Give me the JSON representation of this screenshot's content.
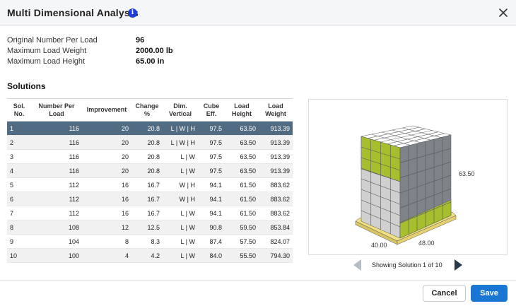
{
  "dialog": {
    "title": "Multi Dimensional Analysis",
    "info_icon": "info-icon",
    "close_icon": "close-icon"
  },
  "summary": [
    {
      "label": "Original Number Per Load",
      "value": "96"
    },
    {
      "label": "Maximum Load Weight",
      "value": "2000.00 lb"
    },
    {
      "label": "Maximum Load Height",
      "value": "65.00 in"
    }
  ],
  "solutions": {
    "heading": "Solutions",
    "columns": [
      {
        "line1": "Sol.",
        "line2": "No."
      },
      {
        "line1": "Number Per",
        "line2": "Load"
      },
      {
        "line1": "Improvement",
        "line2": ""
      },
      {
        "line1": "Change",
        "line2": "%"
      },
      {
        "line1": "Dim.",
        "line2": "Vertical"
      },
      {
        "line1": "Cube",
        "line2": "Eff."
      },
      {
        "line1": "Load",
        "line2": "Height"
      },
      {
        "line1": "Load",
        "line2": "Weight"
      }
    ],
    "rows": [
      [
        "1",
        "116",
        "20",
        "20.8",
        "L | W | H",
        "97.5",
        "63.50",
        "913.39"
      ],
      [
        "2",
        "116",
        "20",
        "20.8",
        "L | W | H",
        "97.5",
        "63.50",
        "913.39"
      ],
      [
        "3",
        "116",
        "20",
        "20.8",
        "L | W",
        "97.5",
        "63.50",
        "913.39"
      ],
      [
        "4",
        "116",
        "20",
        "20.8",
        "L | W",
        "97.5",
        "63.50",
        "913.39"
      ],
      [
        "5",
        "112",
        "16",
        "16.7",
        "W | H",
        "94.1",
        "61.50",
        "883.62"
      ],
      [
        "6",
        "112",
        "16",
        "16.7",
        "W | H",
        "94.1",
        "61.50",
        "883.62"
      ],
      [
        "7",
        "112",
        "16",
        "16.7",
        "L | W",
        "94.1",
        "61.50",
        "883.62"
      ],
      [
        "8",
        "108",
        "12",
        "12.5",
        "L | W",
        "90.8",
        "59.50",
        "853.84"
      ],
      [
        "9",
        "104",
        "8",
        "8.3",
        "L | W",
        "87.4",
        "57.50",
        "824.07"
      ],
      [
        "10",
        "100",
        "4",
        "4.2",
        "L | W",
        "84.0",
        "55.50",
        "794.30"
      ]
    ],
    "selected_row": 0
  },
  "visualization": {
    "height_label": "63.50",
    "length_label": "40.00",
    "width_label": "48.00",
    "colors": {
      "gray": "#7e838a",
      "gray_light": "#d0d0d0",
      "green": "#a7bf2e",
      "pallet": "#f1df86",
      "top": "#ffffff"
    }
  },
  "pager": {
    "text": "Showing Solution 1 of 10",
    "prev_icon": "triangle-left-icon",
    "next_icon": "triangle-right-icon"
  },
  "footer": {
    "cancel_label": "Cancel",
    "save_label": "Save"
  },
  "colors": {
    "accent": "#1976d2",
    "selected_row": "#516b82",
    "info_icon": "#1f3fd6"
  }
}
